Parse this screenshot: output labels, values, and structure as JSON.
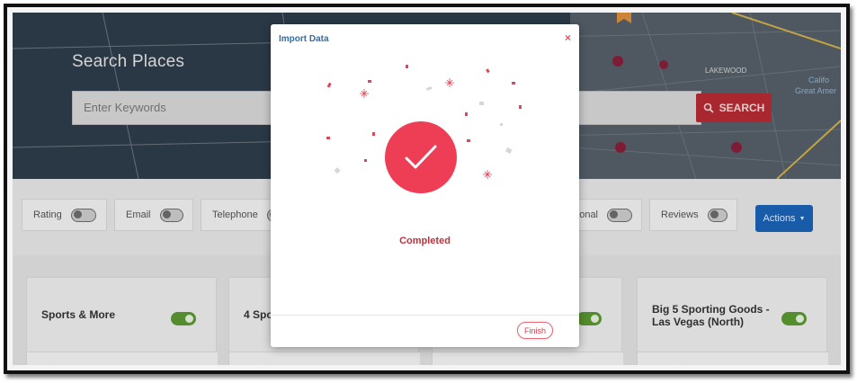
{
  "hero": {
    "title": "Search Places",
    "search_placeholder": "Enter Keywords",
    "search_button": "SEARCH",
    "map_labels": [
      "LAKEWOOD",
      "Califo",
      "Great Amer"
    ]
  },
  "filters": [
    {
      "label": "Rating",
      "on": false
    },
    {
      "label": "Email",
      "on": false
    },
    {
      "label": "Telephone",
      "on": false
    },
    {
      "label": "onal",
      "on": false
    },
    {
      "label": "Reviews",
      "on": false
    }
  ],
  "actions_button": "Actions",
  "cards": [
    {
      "name": "Sports & More",
      "on": true
    },
    {
      "name": "4 Spo",
      "on": false
    },
    {
      "name": "",
      "on": true
    },
    {
      "name": "Big 5 Sporting Goods - Las Vegas (North)",
      "on": true
    }
  ],
  "modal": {
    "title": "Import Data",
    "close": "×",
    "status": "Completed",
    "finish_button": "Finish"
  },
  "colors": {
    "accent_red": "#ee3e56",
    "search_red": "#b82b33",
    "actions_blue": "#1b63b8",
    "toggle_green": "#5b9a31",
    "title_blue": "#2f6ea5"
  }
}
